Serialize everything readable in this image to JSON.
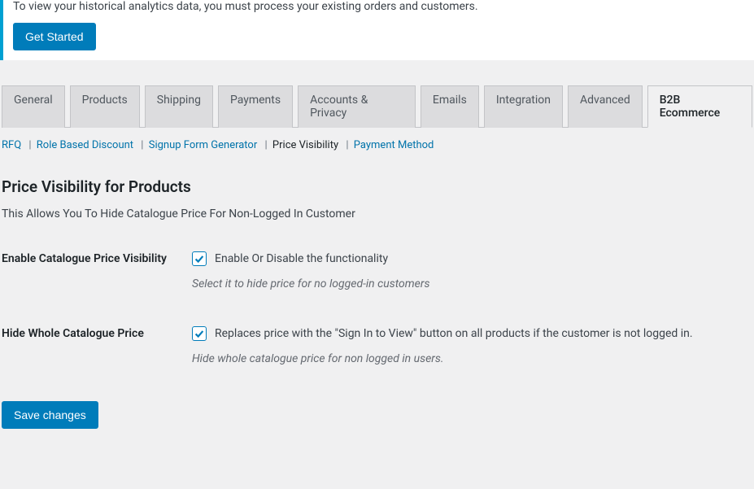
{
  "notice": {
    "text": "To view your historical analytics data, you must process your existing orders and customers.",
    "button_label": "Get Started"
  },
  "tabs": {
    "items": [
      {
        "label": "General"
      },
      {
        "label": "Products"
      },
      {
        "label": "Shipping"
      },
      {
        "label": "Payments"
      },
      {
        "label": "Accounts & Privacy"
      },
      {
        "label": "Emails"
      },
      {
        "label": "Integration"
      },
      {
        "label": "Advanced"
      },
      {
        "label": "B2B Ecommerce"
      }
    ]
  },
  "subtabs": {
    "items": [
      {
        "label": "RFQ"
      },
      {
        "label": "Role Based Discount"
      },
      {
        "label": "Signup Form Generator"
      },
      {
        "label": "Price Visibility"
      },
      {
        "label": "Payment Method"
      }
    ]
  },
  "section": {
    "title": "Price Visibility for Products",
    "description": "This Allows You To Hide Catalogue Price For Non-Logged In Customer"
  },
  "fields": {
    "enable": {
      "label": "Enable Catalogue Price Visibility",
      "checkbox_label": "Enable Or Disable the functionality",
      "help": "Select it to hide price for no logged-in customers"
    },
    "hide_whole": {
      "label": "Hide Whole Catalogue Price",
      "checkbox_label": "Replaces price with the \"Sign In to View\" button on all products if the customer is not logged in.",
      "help": "Hide whole catalogue price for non logged in users."
    }
  },
  "save": {
    "label": "Save changes"
  }
}
